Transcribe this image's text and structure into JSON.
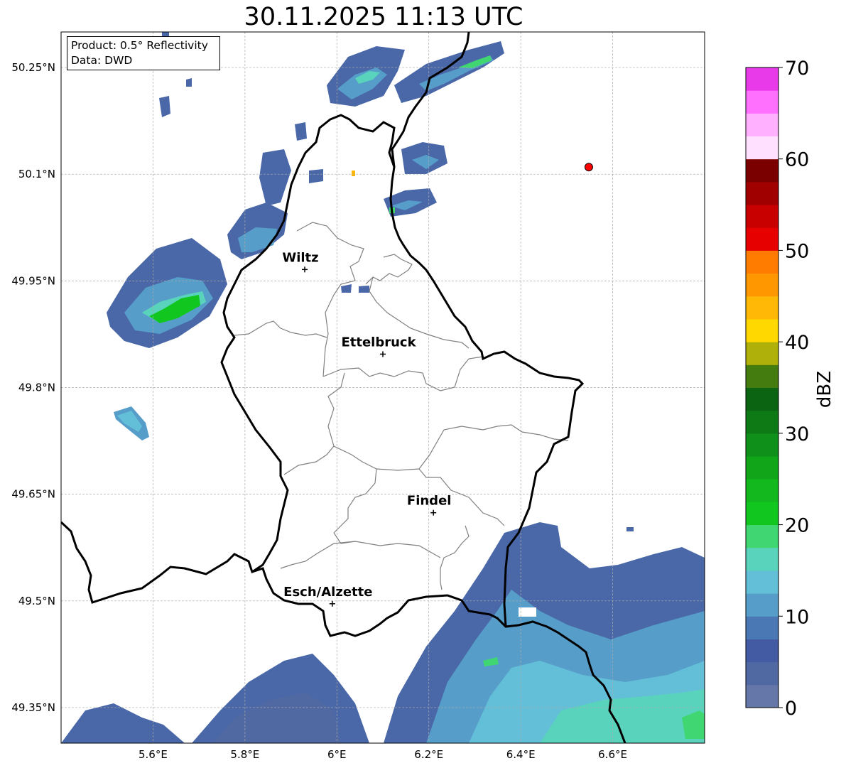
{
  "title": "30.11.2025 11:13 UTC",
  "infobox": {
    "product": "Product: 0.5° Reflectivity",
    "data": "Data: DWD"
  },
  "map": {
    "lon_range": [
      5.4,
      6.8
    ],
    "lat_range": [
      49.3,
      50.3
    ],
    "lon_ticks": [
      {
        "value": 5.6,
        "label": "5.6°E"
      },
      {
        "value": 5.8,
        "label": "5.8°E"
      },
      {
        "value": 6.0,
        "label": "6°E"
      },
      {
        "value": 6.2,
        "label": "6.2°E"
      },
      {
        "value": 6.4,
        "label": "6.4°E"
      },
      {
        "value": 6.6,
        "label": "6.6°E"
      }
    ],
    "lat_ticks": [
      {
        "value": 49.35,
        "label": "49.35°N"
      },
      {
        "value": 49.5,
        "label": "49.5°N"
      },
      {
        "value": 49.65,
        "label": "49.65°N"
      },
      {
        "value": 49.8,
        "label": "49.8°N"
      },
      {
        "value": 49.95,
        "label": "49.95°N"
      },
      {
        "value": 50.1,
        "label": "50.1°N"
      },
      {
        "value": 50.25,
        "label": "50.25°N"
      }
    ],
    "grid": true,
    "cities": [
      {
        "name": "Wiltz",
        "lon": 5.93,
        "lat": 49.966
      },
      {
        "name": "Ettelbruck",
        "lon": 6.1,
        "lat": 49.847
      },
      {
        "name": "Findel",
        "lon": 6.21,
        "lat": 49.624
      },
      {
        "name": "Esch/Alzette",
        "lon": 5.99,
        "lat": 49.496
      }
    ],
    "radar_site": {
      "lon": 6.548,
      "lat": 50.11,
      "color": "#ff0000"
    }
  },
  "colorbar": {
    "label": "dBZ",
    "min": 0,
    "max": 70,
    "ticks": [
      0,
      10,
      20,
      30,
      40,
      50,
      60,
      70
    ],
    "colors": [
      "#6576a9",
      "#5169a3",
      "#435ba3",
      "#4a78b4",
      "#569ec9",
      "#63bfd8",
      "#5ad3bc",
      "#40d671",
      "#12c620",
      "#12b81e",
      "#11a61a",
      "#0f901a",
      "#0d7a15",
      "#0a6412",
      "#457c10",
      "#b0b00a",
      "#ffd800",
      "#ffb805",
      "#ff9800",
      "#ff7c00",
      "#e60000",
      "#c80000",
      "#a00000",
      "#7a0000",
      "#ffe0ff",
      "#ffb0ff",
      "#ff70ff",
      "#e83ae8"
    ]
  }
}
